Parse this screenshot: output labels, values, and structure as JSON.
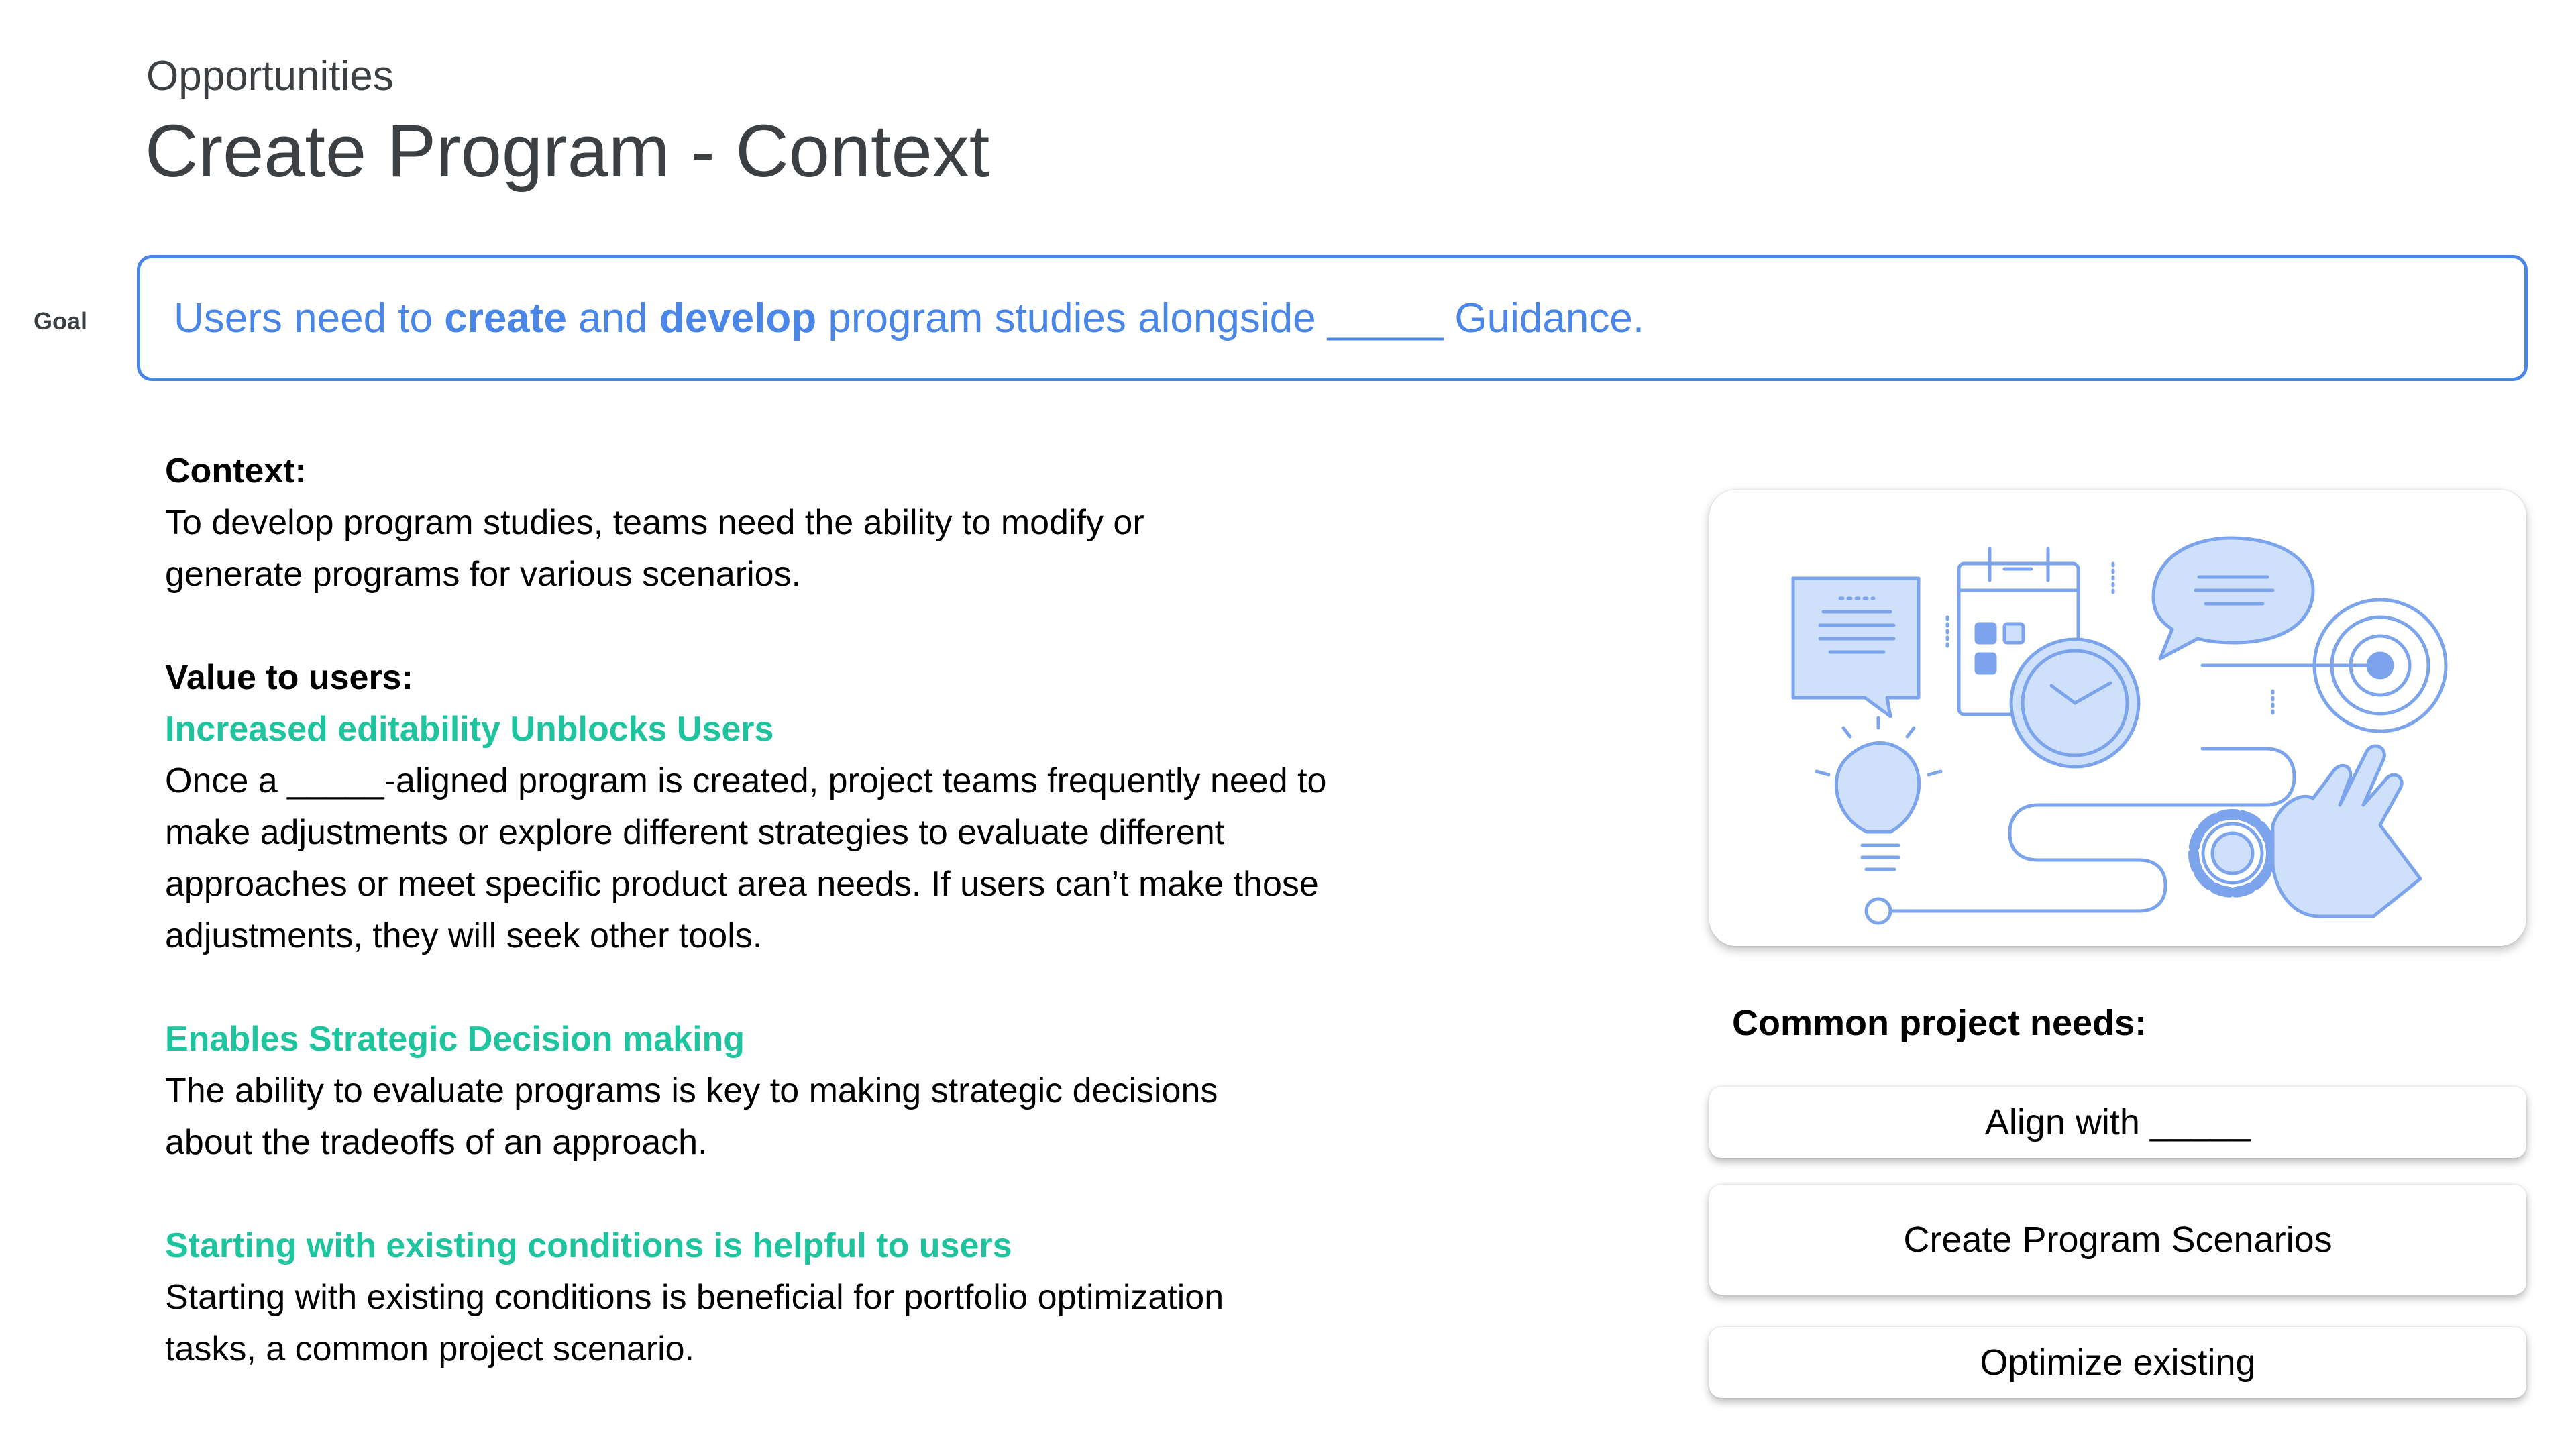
{
  "header": {
    "kicker": "Opportunities",
    "title": "Create Program - Context"
  },
  "goal": {
    "label": "Goal",
    "parts": [
      "Users need to ",
      "create",
      " and ",
      "develop",
      " program studies alongside _____ Guidance."
    ]
  },
  "context": {
    "heading": "Context:",
    "body": "To develop program studies, teams need the ability to modify or generate programs for various scenarios."
  },
  "value": {
    "heading": "Value to users:",
    "items": [
      {
        "title": "Increased editability Unblocks Users",
        "body": "Once a _____-aligned program is created, project teams frequently need to make adjustments or explore different strategies to evaluate different approaches or meet specific product area needs. If users can’t make those adjustments, they will seek other tools."
      },
      {
        "title": "Enables Strategic Decision making",
        "body": "The ability to evaluate programs is key to making strategic decisions about the tradeoffs of an approach."
      },
      {
        "title": "Starting with existing conditions is helpful to users",
        "body": "Starting with existing conditions is beneficial for portfolio optimization tasks, a common project scenario."
      }
    ]
  },
  "needs": {
    "title": "Common project needs:",
    "buttons": [
      "Align with _____",
      "Create Program Scenarios",
      "Optimize existing"
    ]
  },
  "colors": {
    "accent_blue": "#4a86e8",
    "accent_green": "#1ec49e",
    "title_gray": "#3c4043",
    "illustration_blue": "#7ba4ec",
    "illustration_fill": "#cfe0fb"
  }
}
